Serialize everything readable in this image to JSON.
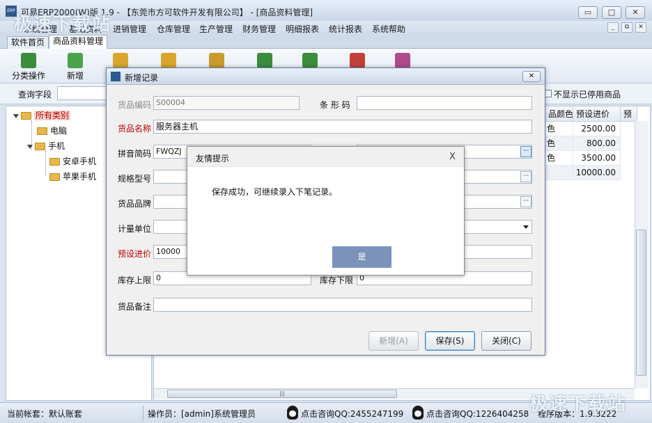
{
  "window": {
    "title": "可易ERP2000(W)版 1.9 - 【东莞市方可软件开发有限公司】 - [商品资料管理]",
    "app_icon": "ERP",
    "minimize_glyph": "▭",
    "maximize_glyph": "□",
    "close_glyph": "✕"
  },
  "menu": {
    "items": [
      "系统管理",
      "基础资料",
      "进销管理",
      "仓库管理",
      "生产管理",
      "财务管理",
      "明细报表",
      "统计报表",
      "系统帮助"
    ],
    "mdi_minimize": "_",
    "mdi_restore": "⧉",
    "mdi_close": "✕"
  },
  "tabs": [
    {
      "label": "软件首页",
      "active": false
    },
    {
      "label": "商品资料管理",
      "active": true
    }
  ],
  "toolbar": {
    "items": [
      {
        "label": "分类操作",
        "icon": "category-icon",
        "color": "#3a8d3a"
      },
      {
        "label": "新增",
        "icon": "add-icon",
        "color": "#4aa24a"
      },
      {
        "label": "",
        "icon": "edit-icon",
        "color": "#d8a62a"
      },
      {
        "label": "",
        "icon": "delete-icon",
        "color": "#d8a62a"
      },
      {
        "label": "",
        "icon": "refresh-icon",
        "color": "#c99a2c"
      },
      {
        "label": "",
        "icon": "excel-icon",
        "color": "#3b8c3b"
      },
      {
        "label": "",
        "icon": "export-icon",
        "color": "#3b8c3b"
      },
      {
        "label": "",
        "icon": "stop-icon",
        "color": "#c2413a"
      },
      {
        "label": "",
        "icon": "table-icon",
        "color": "#b04a8a"
      }
    ]
  },
  "query": {
    "label": "查询字段",
    "hide_disabled_label": "不显示已停用商品"
  },
  "tree": {
    "root": "所有类别",
    "nodes": [
      {
        "label": "电脑",
        "level": 1
      },
      {
        "label": "手机",
        "level": 1
      },
      {
        "label": "安卓手机",
        "level": 2
      },
      {
        "label": "苹果手机",
        "level": 2
      }
    ]
  },
  "grid": {
    "columns": [
      "品颜色",
      "预设进价",
      "预"
    ],
    "rows": [
      {
        "color": "色",
        "price": "2500.00"
      },
      {
        "color": "色",
        "price": "800.00"
      },
      {
        "color": "色",
        "price": "3500.00"
      },
      {
        "color": "",
        "price": "10000.00"
      }
    ],
    "hscroll_glyph": "|||"
  },
  "dialog": {
    "title": "新增记录",
    "close_glyph": "✕",
    "fields": {
      "code_label": "货品编码",
      "code_value": "S00004",
      "barcode_label": "条 形 码",
      "barcode_value": "",
      "name_label": "货品名称",
      "name_value": "服务器主机",
      "pinyin_label": "拼音简码",
      "pinyin_value": "FWQZJ",
      "model_label": "规格型号",
      "model_value": "",
      "brand_label": "货品品牌",
      "brand_value": "",
      "unit_label": "计量单位",
      "unit_value": "",
      "price_label": "预设进价",
      "price_value": "10000",
      "stock_max_label": "库存上限",
      "stock_max_value": "0",
      "stock_min_label": "库存下限",
      "stock_min_value": "0",
      "remark_label": "货品备注",
      "remark_value": ""
    },
    "ellipsis": "···",
    "buttons": {
      "new": "新增(A)",
      "save": "保存(S)",
      "close": "关闭(C)"
    }
  },
  "message": {
    "title": "友情提示",
    "close_glyph": "X",
    "text": "保存成功，可继续录入下笔记录。",
    "yes": "是"
  },
  "status": {
    "account": "当前帐套：默认账套",
    "operator": "操作员：[admin]系统管理员",
    "qq1": "点击咨询QQ:2455247199",
    "qq2": "点击咨询QQ:1226404258",
    "version": "程序版本：1.9.3222"
  },
  "watermark": {
    "top": "极速下载站",
    "bottom": "极速下载站"
  }
}
